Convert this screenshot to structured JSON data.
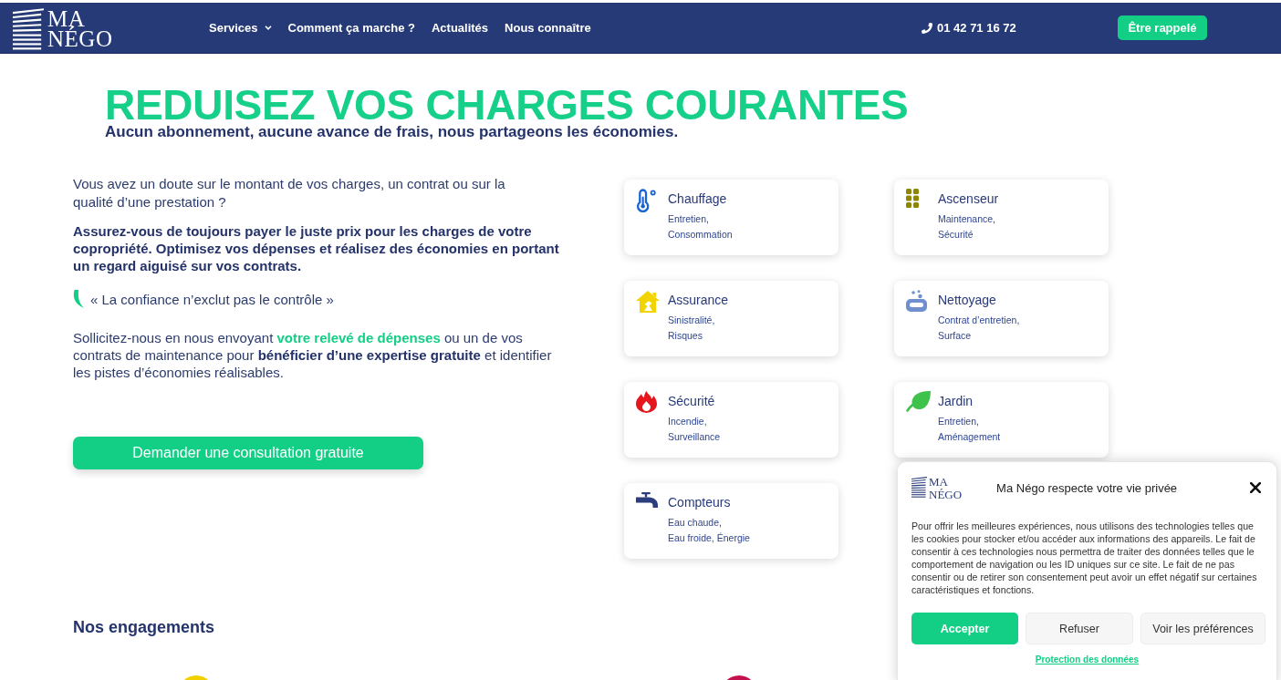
{
  "header": {
    "logo": {
      "lines": [
        "MA",
        "NÉGO"
      ]
    },
    "nav": [
      {
        "label": "Services",
        "has_menu": true
      },
      {
        "label": "Comment ça marche ?",
        "has_menu": false
      },
      {
        "label": "Actualités",
        "has_menu": false
      },
      {
        "label": "Nous connaître",
        "has_menu": false
      }
    ],
    "phone": "01 42 71 16 72",
    "callback_button": "Être rappelé"
  },
  "hero": {
    "title": "REDUISEZ VOS CHARGES COURANTES",
    "subtitle": "Aucun abonnement, aucune avance de frais, nous partageons les économies."
  },
  "intro": {
    "question": "Vous avez un doute sur le montant de vos charges, un contrat ou sur la qualité d’une prestation ?",
    "statement": "Assurez-vous de toujours payer le juste prix pour les charges de votre copropriété. Optimisez vos dépenses et réalisez des économies en portant un regard aiguisé sur vos contrats.",
    "quote": "« La confiance n’exclut pas le contrôle »",
    "call_to_action": [
      {
        "kind": "text",
        "text": "Sollicitez-nous en nous envoyant "
      },
      {
        "kind": "link",
        "text": "votre relevé de dépenses"
      },
      {
        "kind": "text",
        "text": " ou un de vos contrats de maintenance pour **bénéficier d’une expertise gratuite** et identifier les pistes d’économies réalisables."
      }
    ],
    "button": "Demander une consultation gratuite"
  },
  "services": [
    {
      "title": "Chauffage",
      "details": [
        "Entretien,",
        "Consommation"
      ]
    },
    {
      "title": "Ascenseur",
      "details": [
        "Maintenance,",
        "Sécurité"
      ]
    },
    {
      "title": "Assurance",
      "details": [
        "Sinistralité,",
        "Risques"
      ]
    },
    {
      "title": "Nettoyage",
      "details": [
        "Contrat d’entretien,",
        "Surface"
      ]
    },
    {
      "title": "Sécurité",
      "details": [
        "Incendie,",
        "Surveillance"
      ]
    },
    {
      "title": "Jardin",
      "details": [
        "Entretien,",
        "Aménagement"
      ]
    },
    {
      "title": "Compteurs",
      "details": [
        "Eau chaude,",
        "Eau froide, Énergie"
      ]
    }
  ],
  "engagements": {
    "title": "Nos engagements"
  },
  "cookie_dialog": {
    "logo": {
      "lines": [
        "MA",
        "NÉGO"
      ]
    },
    "title": "Ma Négo respecte votre vie privée",
    "text": "Pour offrir les meilleures expériences, nous utilisons des technologies telles que les cookies pour stocker et/ou accéder aux informations des appareils. Le fait de consentir à ces technologies nous permettra de traiter des données telles que le comportement de navigation ou les ID uniques sur ce site. Le fait de ne pas consentir ou de retirer son consentement peut avoir un effet négatif sur certaines caractéristiques et fonctions.",
    "buttons": [
      {
        "label": "Accepter",
        "kind": "primary"
      },
      {
        "label": "Refuser",
        "kind": "secondary"
      },
      {
        "label": "Voir les préférences",
        "kind": "secondary"
      }
    ],
    "link": "Protection des données"
  }
}
